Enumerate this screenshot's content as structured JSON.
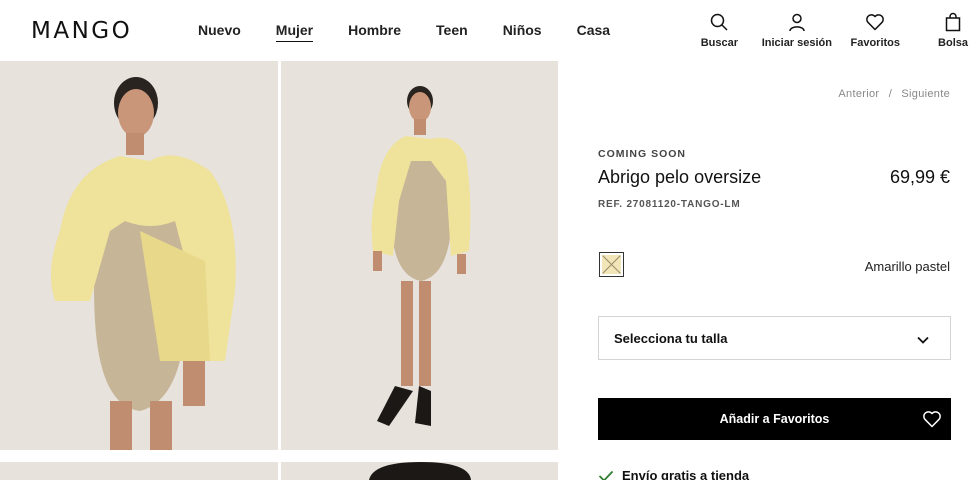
{
  "brand": {
    "logo": "MANGO"
  },
  "nav": [
    {
      "label": "Nuevo"
    },
    {
      "label": "Mujer",
      "active": true
    },
    {
      "label": "Hombre"
    },
    {
      "label": "Teen"
    },
    {
      "label": "Niños"
    },
    {
      "label": "Casa"
    }
  ],
  "actions": {
    "search": {
      "label": "Buscar",
      "icon": "search-icon"
    },
    "login": {
      "label": "Iniciar sesión",
      "icon": "user-icon"
    },
    "favorites": {
      "label": "Favoritos",
      "icon": "heart-icon"
    },
    "bag": {
      "label": "Bolsa",
      "icon": "bag-icon"
    }
  },
  "pager": {
    "previous": "Anterior",
    "separator": "/",
    "next": "Siguiente"
  },
  "product": {
    "status": "COMING SOON",
    "name": "Abrigo pelo oversize",
    "price": "69,99 €",
    "ref": "REF. 27081120-TANGO-LM",
    "color": {
      "name": "Amarillo pastel",
      "swatch": "#f2e6b8"
    },
    "size_placeholder": "Selecciona tu talla",
    "add_favorites": "Añadir a Favoritos",
    "shipping": "Envío gratis a tienda"
  },
  "colors": {
    "accent": "#000000",
    "check": "#2e7d32",
    "photo_bg": "#e7e2dc",
    "fur": "#efe29a",
    "dress": "#c7b597"
  }
}
